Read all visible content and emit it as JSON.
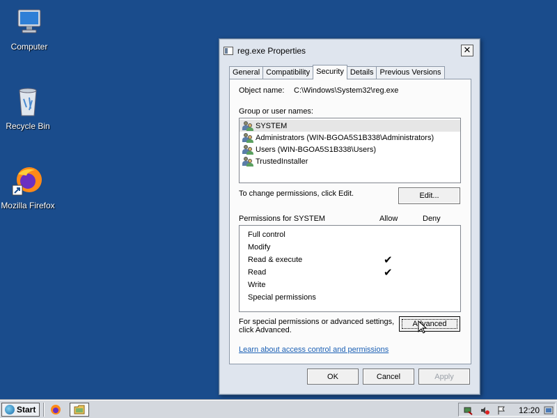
{
  "desktop": {
    "icons": [
      {
        "label": "Computer"
      },
      {
        "label": "Recycle Bin"
      },
      {
        "label": "Mozilla Firefox"
      }
    ]
  },
  "window": {
    "title": "reg.exe Properties",
    "close_glyph": "✕",
    "tabs": [
      "General",
      "Compatibility",
      "Security",
      "Details",
      "Previous Versions"
    ],
    "active_tab": "Security",
    "object_name_label": "Object name:",
    "object_name_value": "C:\\Windows\\System32\\reg.exe",
    "group_label": "Group or user names:",
    "users": [
      "SYSTEM",
      "Administrators (WIN-BGOA5S1B338\\Administrators)",
      "Users (WIN-BGOA5S1B338\\Users)",
      "TrustedInstaller"
    ],
    "selected_user": "SYSTEM",
    "change_perm_text": "To change permissions, click Edit.",
    "edit_button": "Edit...",
    "permissions_label": "Permissions for SYSTEM",
    "allow_header": "Allow",
    "deny_header": "Deny",
    "permissions": [
      {
        "name": "Full control",
        "allow": "",
        "deny": ""
      },
      {
        "name": "Modify",
        "allow": "",
        "deny": ""
      },
      {
        "name": "Read & execute",
        "allow": "✔",
        "deny": ""
      },
      {
        "name": "Read",
        "allow": "✔",
        "deny": ""
      },
      {
        "name": "Write",
        "allow": "",
        "deny": ""
      },
      {
        "name": "Special permissions",
        "allow": "",
        "deny": ""
      }
    ],
    "special_text_1": "For special permissions or advanced settings,",
    "special_text_2": "click Advanced.",
    "advanced_button": "Advanced",
    "learn_link": "Learn about access control and permissions",
    "ok_button": "OK",
    "cancel_button": "Cancel",
    "apply_button": "Apply"
  },
  "taskbar": {
    "start_label": "Start",
    "clock": "12:20"
  }
}
